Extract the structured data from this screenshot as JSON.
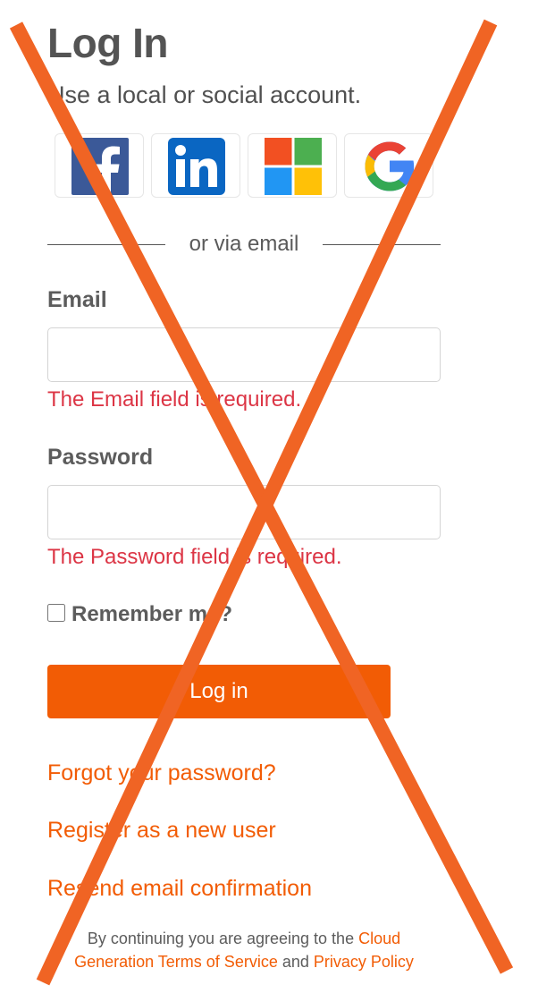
{
  "header": {
    "title": "Log In",
    "subtitle": "Use a local or social account."
  },
  "social": {
    "providers": [
      "facebook-icon",
      "linkedin-icon",
      "microsoft-icon",
      "google-icon"
    ]
  },
  "divider": {
    "text": "or via email"
  },
  "form": {
    "email": {
      "label": "Email",
      "value": "",
      "placeholder": "",
      "error": "The Email field is required."
    },
    "password": {
      "label": "Password",
      "value": "",
      "placeholder": "",
      "error": "The Password field is required."
    },
    "remember": {
      "label": "Remember me?",
      "checked": false
    },
    "submit_label": "Log in"
  },
  "links": {
    "forgot": "Forgot your password?",
    "register": "Register as a new user",
    "resend": "Resend email confirmation"
  },
  "terms": {
    "prefix": "By continuing you are agreeing to the ",
    "tos_link": "Cloud Generation Terms of Service",
    "conjunction": " and ",
    "privacy_link": "Privacy Policy"
  },
  "colors": {
    "accent": "#f25c05",
    "error": "#dc3545",
    "cross": "#f06424"
  }
}
